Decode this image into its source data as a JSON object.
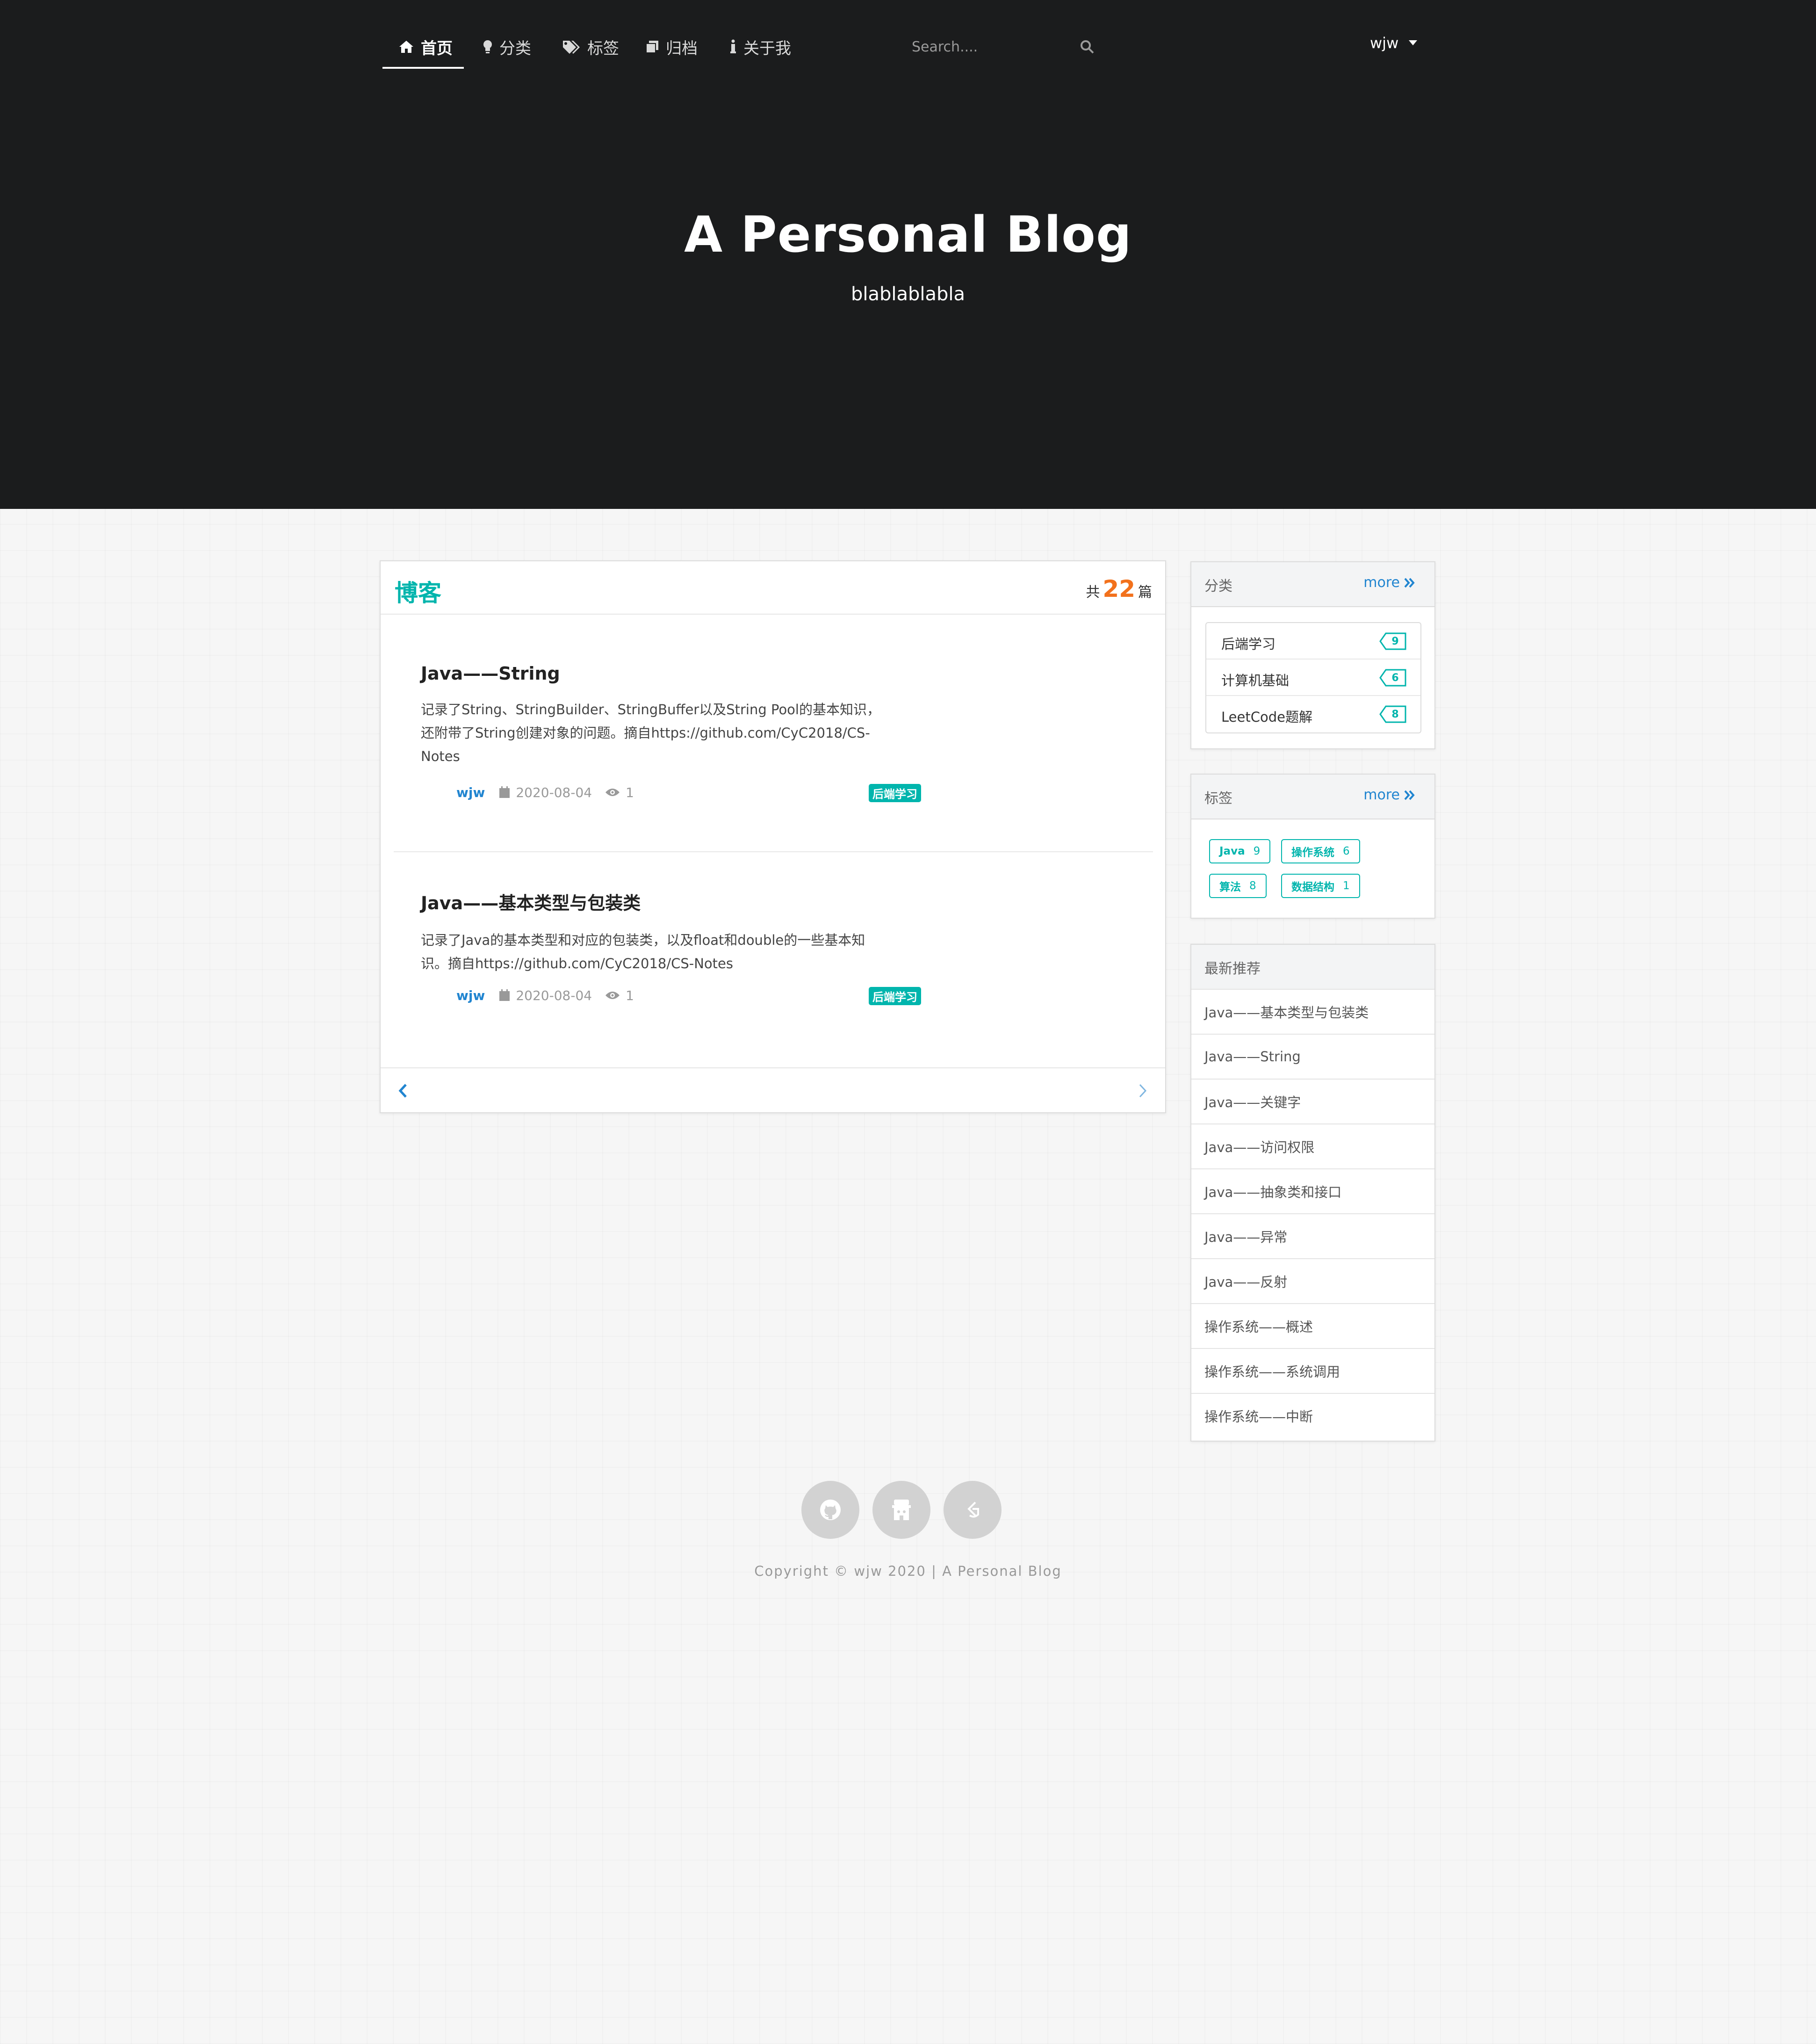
{
  "nav": {
    "items": [
      {
        "label": "首页",
        "icon": "home-icon"
      },
      {
        "label": "分类",
        "icon": "lightbulb-icon"
      },
      {
        "label": "标签",
        "icon": "tags-icon"
      },
      {
        "label": "归档",
        "icon": "archive-icon"
      },
      {
        "label": "关于我",
        "icon": "info-icon"
      }
    ],
    "search_placeholder": "Search....",
    "user": "wjw"
  },
  "hero": {
    "title": "A Personal Blog",
    "subtitle": "blablablabla"
  },
  "blog": {
    "heading": "博客",
    "count_prefix": "共",
    "count": "22",
    "count_suffix": "篇",
    "posts": [
      {
        "title": "Java——String",
        "excerpt_lines": [
          "记录了String、StringBuilder、StringBuffer以及String Pool的基本知识，",
          "还附带了String创建对象的问题。摘自https://github.com/CyC2018/CS-",
          "Notes"
        ],
        "author": "wjw",
        "date": "2020-08-04",
        "views": "1",
        "tag": "后端学习"
      },
      {
        "title": "Java——基本类型与包装类",
        "excerpt_lines": [
          "记录了Java的基本类型和对应的包装类，以及float和double的一些基本知",
          "识。摘自https://github.com/CyC2018/CS-Notes"
        ],
        "author": "wjw",
        "date": "2020-08-04",
        "views": "1",
        "tag": "后端学习"
      }
    ]
  },
  "categories": {
    "title": "分类",
    "more": "more",
    "items": [
      {
        "name": "后端学习",
        "count": "9"
      },
      {
        "name": "计算机基础",
        "count": "6"
      },
      {
        "name": "LeetCode题解",
        "count": "8"
      }
    ]
  },
  "tags": {
    "title": "标签",
    "more": "more",
    "items": [
      {
        "name": "Java",
        "count": "9"
      },
      {
        "name": "操作系统",
        "count": "6"
      },
      {
        "name": "算法",
        "count": "8"
      },
      {
        "name": "数据结构",
        "count": "1"
      }
    ]
  },
  "recommended": {
    "title": "最新推荐",
    "items": [
      "Java——基本类型与包装类",
      "Java——String",
      "Java——关键字",
      "Java——访问权限",
      "Java——抽象类和接口",
      "Java——异常",
      "Java——反射",
      "操作系统——概述",
      "操作系统——系统调用",
      "操作系统——中断"
    ]
  },
  "footer": {
    "social": [
      "github-icon",
      "wechat-icon",
      "juejin-icon"
    ],
    "copyright": "Copyright © wjw 2020 | A Personal Blog"
  },
  "colors": {
    "hero_bg": "#1b1c1d",
    "teal": "#00b5ad",
    "blue": "#2185d0",
    "orange": "#f2711c"
  }
}
